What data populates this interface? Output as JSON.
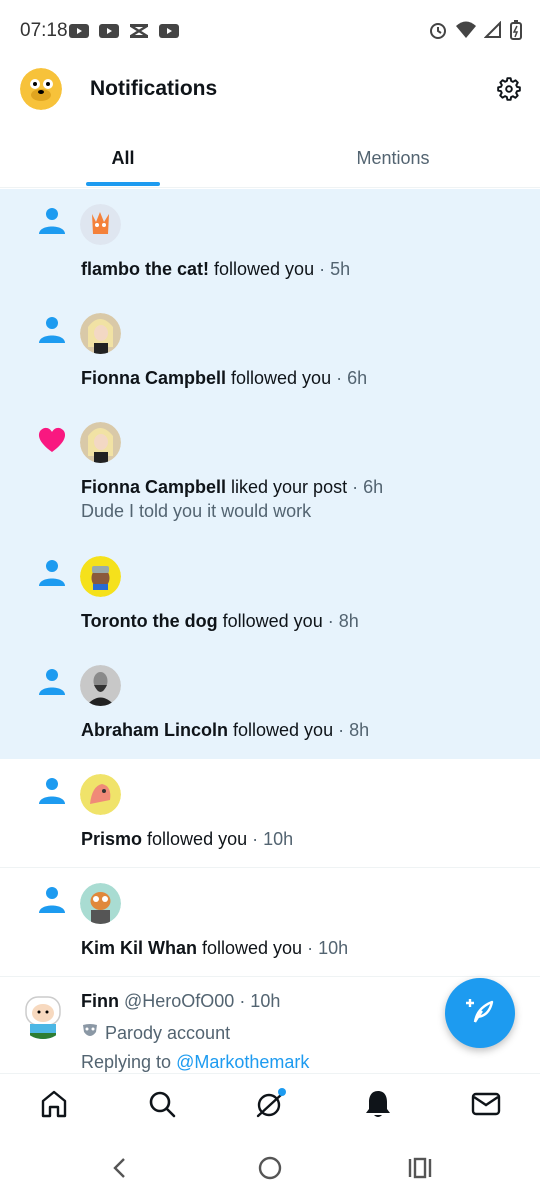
{
  "status_bar": {
    "time": "07:18",
    "left_icons": [
      "youtube-icon",
      "youtube-icon",
      "capcut-icon",
      "youtube-icon"
    ],
    "right_icons": [
      "alarm-icon",
      "wifi-icon",
      "signal-icon",
      "battery-icon"
    ]
  },
  "header": {
    "title": "Notifications",
    "avatar_icon": "profile-avatar",
    "settings_icon": "gear-icon"
  },
  "tabs": [
    {
      "label": "All",
      "active": true
    },
    {
      "label": "Mentions",
      "active": false
    }
  ],
  "notifications": [
    {
      "type": "follow",
      "name": "flambo the cat!",
      "action": " followed you",
      "time": " · 5h",
      "unread": true,
      "avatar_color": "#f4a64a"
    },
    {
      "type": "follow",
      "name": "Fionna Campbell",
      "action": " followed you",
      "time": " · 6h",
      "unread": true,
      "avatar_color": "#e8d49a"
    },
    {
      "type": "like",
      "name": "Fionna Campbell",
      "action": " liked your post",
      "time": " · 6h",
      "sub": "Dude I told you it would work",
      "unread": true,
      "avatar_color": "#e8d49a"
    },
    {
      "type": "follow",
      "name": "Toronto the dog",
      "action": " followed you",
      "time": " · 8h",
      "unread": true,
      "avatar_color": "#f5e11b"
    },
    {
      "type": "follow",
      "name": "Abraham Lincoln",
      "action": " followed you",
      "time": " · 8h",
      "unread": true,
      "avatar_color": "#9a9a9a"
    },
    {
      "type": "follow",
      "name": "Prismo",
      "action": " followed you",
      "time": " · 10h",
      "unread": false,
      "avatar_color": "#f0e36a"
    },
    {
      "type": "follow",
      "name": "Kim Kil Whan",
      "action": " followed you",
      "time": " · 10h",
      "unread": false,
      "avatar_color": "#a9dcd2"
    }
  ],
  "post": {
    "name": "Finn",
    "handle": " @HeroOfO00",
    "time": " · 10h",
    "parody": "Parody account",
    "reply_prefix": "Replying to ",
    "reply_mention": "@Markothemark"
  },
  "fab": {
    "icon": "compose-post-icon"
  },
  "bottom_nav": [
    "home-icon",
    "search-icon",
    "grok-icon",
    "bell-icon",
    "mail-icon"
  ],
  "colors": {
    "accent": "#1d9bf0",
    "like": "#f91880",
    "unread_bg": "#e7f3fc",
    "secondary_text": "#536471"
  }
}
